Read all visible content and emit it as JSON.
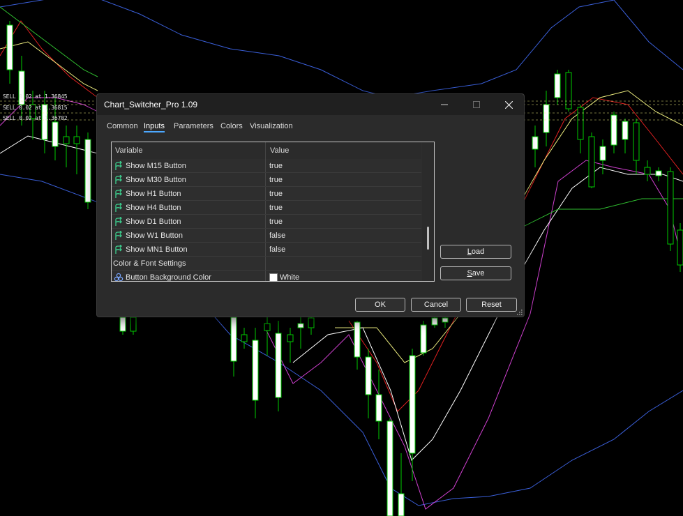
{
  "chart": {
    "trade_labels": [
      "SELL 0.02 at 1.36845",
      "SELL 0.02 at 1.36815",
      "SELL 0.02 at 1.36702"
    ],
    "colors": {
      "background": "#000000",
      "bull_candle": "#ffffff",
      "bear_candle": "#000000",
      "wick": "#00cc00",
      "band_blue": "#3a5fd9",
      "ma_red": "#e02020",
      "ma_yellow": "#f0f080",
      "ma_magenta": "#d040d0",
      "ma_white": "#ffffff",
      "ma_green": "#30c030"
    }
  },
  "dialog": {
    "title": "Chart_Switcher_Pro 1.09",
    "window_controls": {
      "minimize_icon": "minimize-icon",
      "maximize_icon": "maximize-icon",
      "close_icon": "close-icon"
    },
    "tabs": [
      {
        "label": "Common",
        "active": false
      },
      {
        "label": "Inputs",
        "active": true
      },
      {
        "label": "Parameters",
        "active": false
      },
      {
        "label": "Colors",
        "active": false
      },
      {
        "label": "Visualization",
        "active": false
      }
    ],
    "table": {
      "headers": {
        "variable": "Variable",
        "value": "Value"
      },
      "rows": [
        {
          "variable": "Show M15 Button",
          "value": "true",
          "icon": "input-arrow-icon"
        },
        {
          "variable": "Show M30 Button",
          "value": "true",
          "icon": "input-arrow-icon"
        },
        {
          "variable": "Show H1 Button",
          "value": "true",
          "icon": "input-arrow-icon"
        },
        {
          "variable": "Show H4 Button",
          "value": "true",
          "icon": "input-arrow-icon"
        },
        {
          "variable": "Show D1 Button",
          "value": "true",
          "icon": "input-arrow-icon"
        },
        {
          "variable": "Show W1 Button",
          "value": "false",
          "icon": "input-arrow-icon"
        },
        {
          "variable": "Show MN1 Button",
          "value": "false",
          "icon": "input-arrow-icon"
        },
        {
          "variable": "Color & Font Settings",
          "value": "",
          "icon": ""
        },
        {
          "variable": "Button Background Color",
          "value": "White",
          "icon": "color-palette-icon",
          "swatch": "#ffffff"
        }
      ]
    },
    "side_buttons": {
      "load": "Load",
      "save": "Save"
    },
    "footer_buttons": {
      "ok": "OK",
      "cancel": "Cancel",
      "reset": "Reset"
    }
  }
}
